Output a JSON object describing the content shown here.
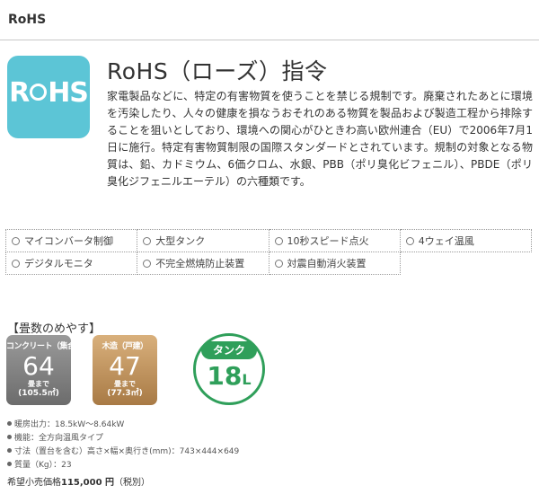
{
  "section": {
    "heading": "RoHS"
  },
  "logo": {
    "r": "R",
    "h": "H",
    "s": "S"
  },
  "title": "RoHS（ローズ）指令",
  "description": "家電製品などに、特定の有害物質を使うことを禁じる規制です。廃棄されたあとに環境を汚染したり、人々の健康を損なうおそれのある物質を製品および製造工程から排除することを狙いとしており、環境への関心がひときわ高い欧州連合（EU）で2006年7月1日に施行。特定有害物質制限の国際スタンダードとされています。規制の対象となる物質は、鉛、カドミウム、6価クロム、水銀、PBB（ポリ臭化ビフェニル）、PBDE（ポリ臭化ジフェニルエーテル）の六種類です。",
  "features": {
    "row1": [
      "マイコンバータ制御",
      "大型タンク",
      "10秒スピード点火",
      "4ウェイ温風"
    ],
    "row2": [
      "デジタルモニタ",
      "不完全燃焼防止装置",
      "対震自動消火装置"
    ]
  },
  "guide_title": "【畳数のめやす】",
  "concrete": {
    "label": "コンクリート（集合）",
    "value": "64",
    "unit": "畳まで",
    "area": "(105.5㎡)"
  },
  "wood": {
    "label": "木造（戸建）",
    "value": "47",
    "unit": "畳まで",
    "area": "(77.3㎡)"
  },
  "tank": {
    "label": "タンク",
    "value": "18",
    "unit": "L"
  },
  "specs": {
    "output": "暖房出力：18.5kW～8.64kW",
    "function": "機能：全方向温風タイプ",
    "size": "寸法（置台を含む）高さ×幅×奥行き(mm)：743×444×649",
    "weight": "質量（Kg）：23"
  },
  "price": {
    "prefix": "希望小売価格",
    "amount": "115,000 円",
    "suffix": "（税別）"
  },
  "colors": {
    "logo_bg": "#5cc5d6",
    "tank_green": "#2f9f5a",
    "concrete_gray": "#808080",
    "wood_brown": "#c09060"
  }
}
